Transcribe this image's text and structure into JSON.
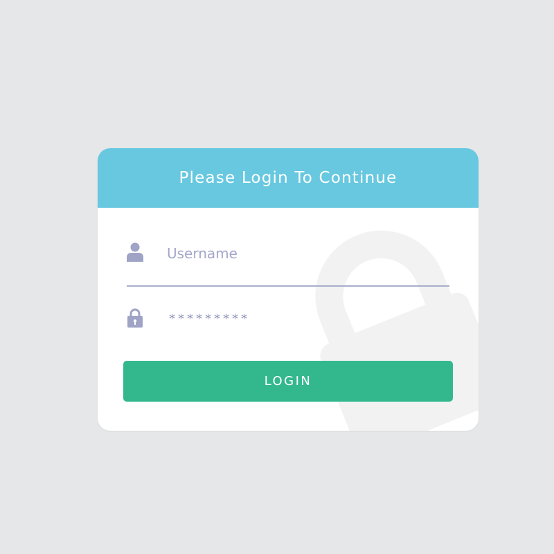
{
  "login_card": {
    "title": "Please Login To Continue",
    "username": {
      "placeholder": "Username",
      "value": ""
    },
    "password": {
      "masked_value": "*********"
    },
    "login_button_label": "LOGIN"
  },
  "icons": {
    "username_icon": "user-icon",
    "password_icon": "lock-icon",
    "background_decoration": "padlock-icon"
  },
  "colors": {
    "page_background": "#e6e7e9",
    "header": "#67c8e0",
    "button": "#33b88e",
    "field_accent": "#a3a7c9"
  }
}
